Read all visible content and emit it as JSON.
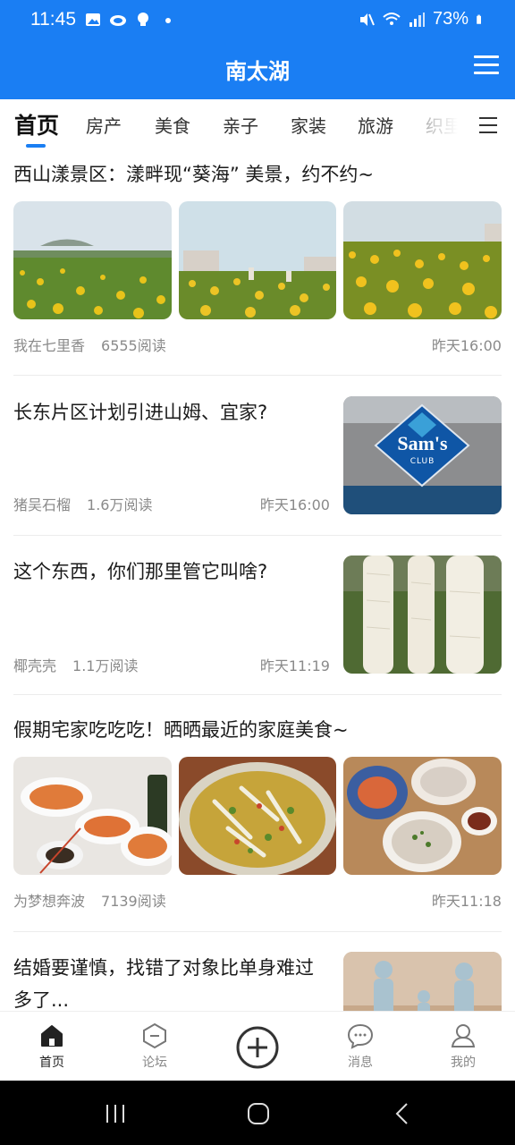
{
  "status_bar": {
    "time": "11:45",
    "battery": "73%"
  },
  "app_bar": {
    "title": "南太湖"
  },
  "tabs": [
    "首页",
    "房产",
    "美食",
    "亲子",
    "家装",
    "旅游",
    "织里"
  ],
  "posts": [
    {
      "title": "西山漾景区：漾畔现“葵海” 美景，约不约~",
      "author": "我在七里香",
      "reads": "6555阅读",
      "time": "昨天16:00"
    },
    {
      "title": "长东片区计划引进山姆、宜家?",
      "author": "猪吴石榴",
      "reads": "1.6万阅读",
      "time": "昨天16:00",
      "image_text": "Sam's",
      "image_subtext": "CLUB"
    },
    {
      "title": "这个东西，你们那里管它叫啥?",
      "author": "椰壳壳",
      "reads": "1.1万阅读",
      "time": "昨天11:19"
    },
    {
      "title": "假期宅家吃吃吃！晒晒最近的家庭美食~",
      "author": "为梦想奔波",
      "reads": "7139阅读",
      "time": "昨天11:18"
    },
    {
      "title": "结婚要谨慎，找错了对象比单身难过多了..."
    }
  ],
  "bottom_nav": [
    {
      "label": "首页",
      "icon": "home-icon"
    },
    {
      "label": "论坛",
      "icon": "forum-icon"
    },
    {
      "label": "",
      "icon": "add-icon"
    },
    {
      "label": "消息",
      "icon": "message-icon"
    },
    {
      "label": "我的",
      "icon": "profile-icon"
    }
  ],
  "colors": {
    "brand": "#1a7ef3",
    "meta_text": "#8a8a8a"
  }
}
